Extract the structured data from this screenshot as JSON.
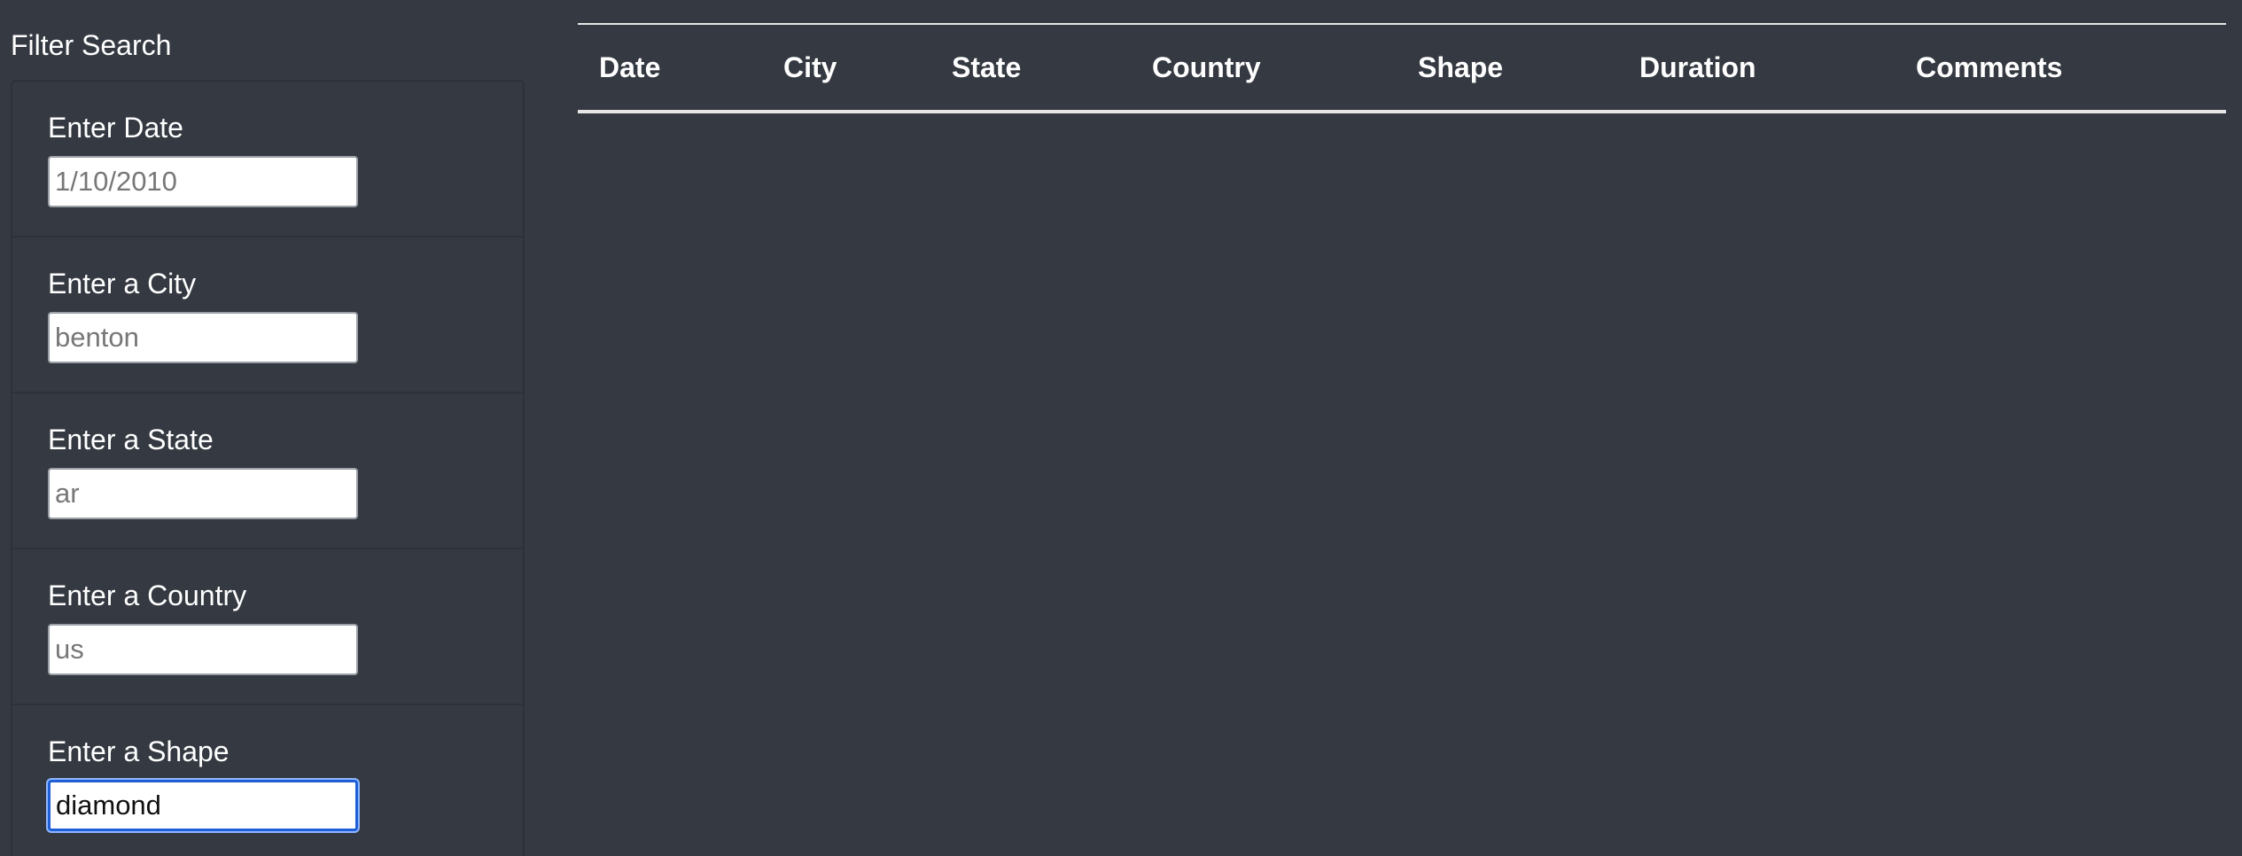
{
  "sidebar": {
    "title": "Filter Search",
    "filters": [
      {
        "label": "Enter Date",
        "placeholder": "1/10/2010",
        "value": ""
      },
      {
        "label": "Enter a City",
        "placeholder": "benton",
        "value": ""
      },
      {
        "label": "Enter a State",
        "placeholder": "ar",
        "value": ""
      },
      {
        "label": "Enter a Country",
        "placeholder": "us",
        "value": ""
      },
      {
        "label": "Enter a Shape",
        "placeholder": "",
        "value": "diamond"
      }
    ]
  },
  "table": {
    "columns": [
      "Date",
      "City",
      "State",
      "Country",
      "Shape",
      "Duration",
      "Comments"
    ],
    "rows": []
  },
  "colors": {
    "background": "#353a42",
    "text": "#ffffff",
    "focus_border": "#1f5fd6"
  }
}
